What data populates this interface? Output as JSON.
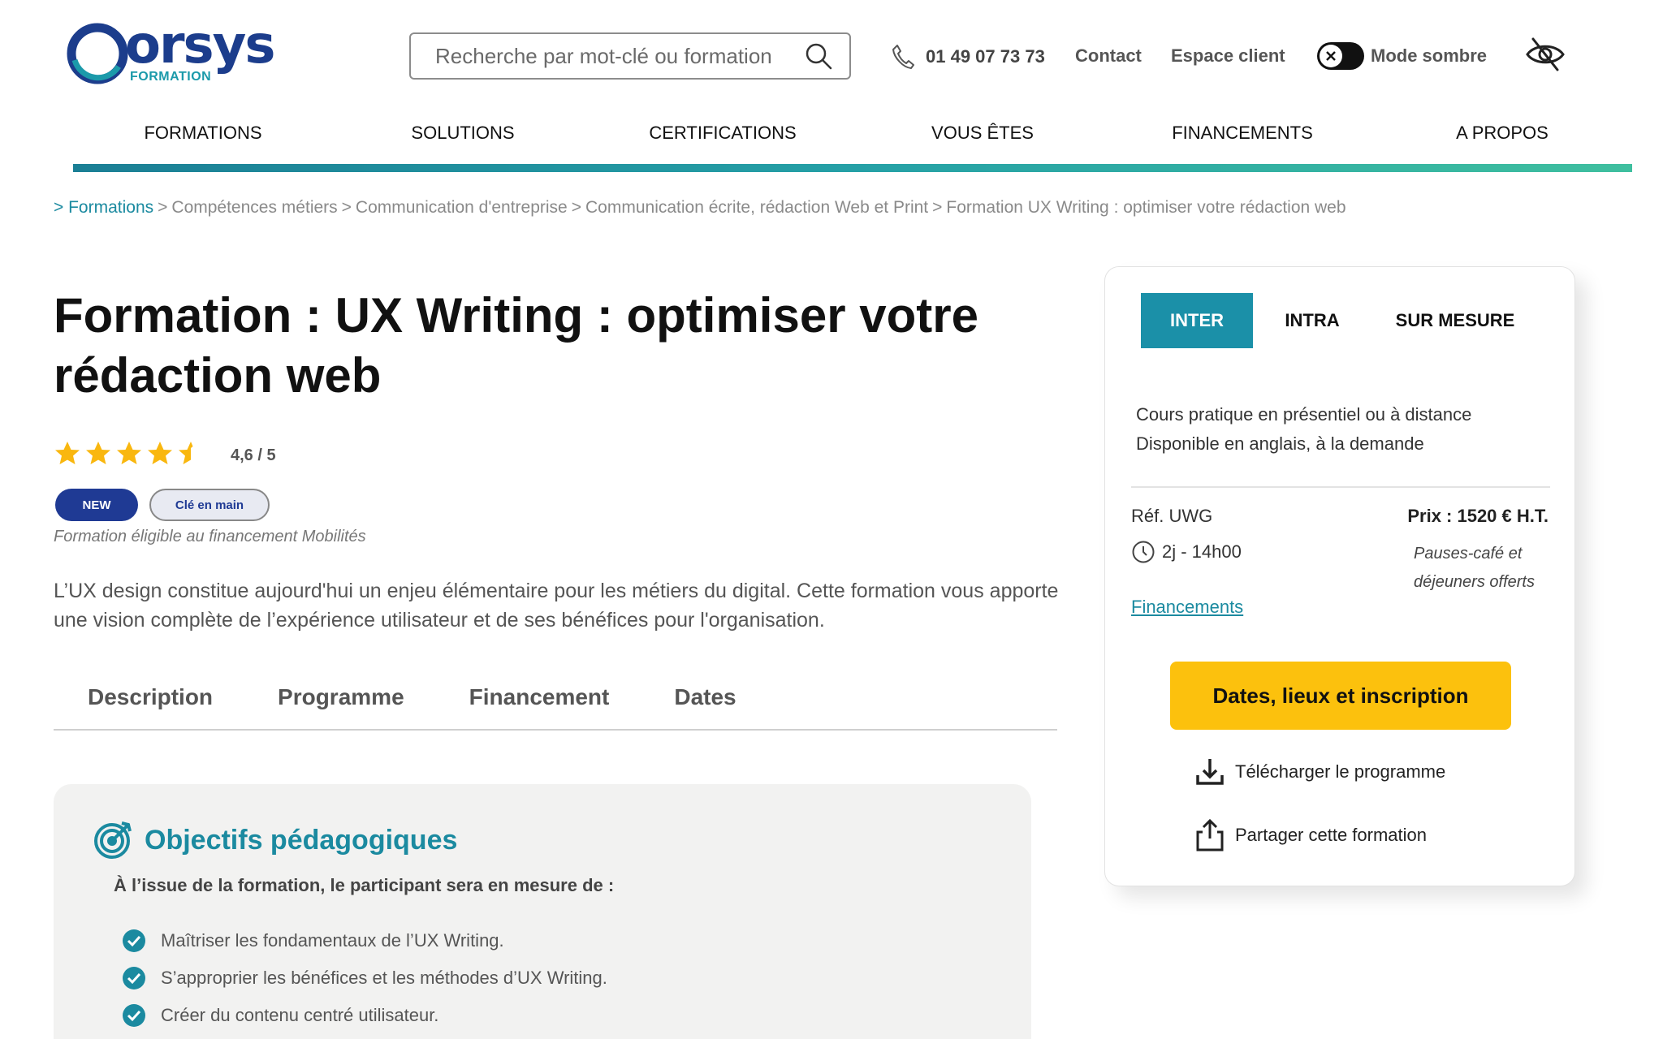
{
  "header": {
    "logo": {
      "word": "orsys",
      "sub": "FORMATION"
    },
    "search_placeholder": "Recherche par mot-clé ou formation",
    "phone": "01 49 07 73 73",
    "contact": "Contact",
    "client": "Espace client",
    "dark_mode": "Mode sombre"
  },
  "nav": [
    "FORMATIONS",
    "SOLUTIONS",
    "CERTIFICATIONS",
    "VOUS ÊTES",
    "FINANCEMENTS",
    "A PROPOS"
  ],
  "breadcrumb": [
    "Formations",
    "Compétences métiers",
    "Communication d'entreprise",
    "Communication écrite, rédaction Web et Print",
    "Formation UX Writing : optimiser votre rédaction web"
  ],
  "title": "Formation : UX Writing : optimiser votre rédaction web",
  "rating": {
    "value": 4.6,
    "label": "4,6 / 5"
  },
  "badges": {
    "new": "NEW",
    "key": "Clé en main"
  },
  "eligible": "Formation éligible au financement Mobilités",
  "intro": "L’UX design constitue aujourd'hui un enjeu élémentaire pour les métiers du digital. Cette formation vous apporte une vision complète de l’expérience utilisateur et de ses bénéfices pour l'organisation.",
  "tabs": [
    "Description",
    "Programme",
    "Financement",
    "Dates"
  ],
  "objectives": {
    "title": "Objectifs pédagogiques",
    "subtitle": "À l’issue de la formation, le participant sera en mesure de :",
    "items": [
      "Maîtriser les fondamentaux de l’UX Writing.",
      "S’approprier les bénéfices et les méthodes d’UX Writing.",
      "Créer du contenu centré utilisateur."
    ]
  },
  "card": {
    "tabs": [
      "INTER",
      "INTRA",
      "SUR MESURE"
    ],
    "desc1": "Cours pratique en présentiel ou à distance",
    "desc2": "Disponible en anglais, à la demande",
    "ref": "Réf. UWG",
    "duration": "2j - 14h00",
    "price": "Prix : 1520 € H.T.",
    "pause": "Pauses-café et déjeuners offerts",
    "financements": "Financements",
    "cta": "Dates, lieux et inscription",
    "download": "Télécharger le programme",
    "share": "Partager cette formation"
  },
  "colors": {
    "brand_navy": "#1c3d8c",
    "brand_teal": "#1b8aa0",
    "cta_yellow": "#fcc10d",
    "star_yellow": "#f9b70f"
  }
}
